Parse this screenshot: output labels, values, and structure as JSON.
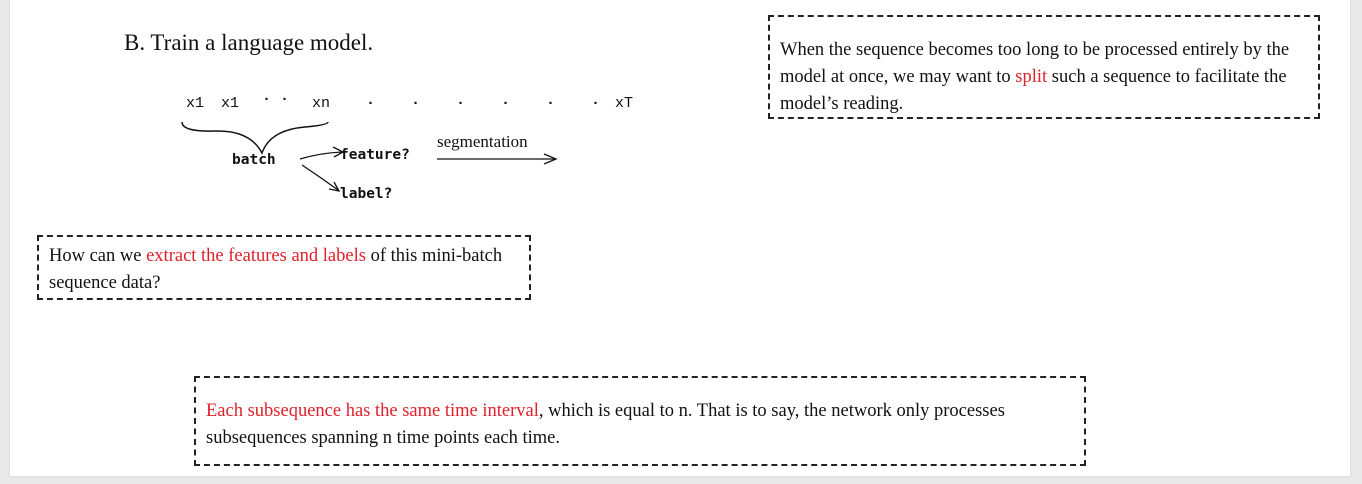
{
  "title": "B. Train a language model.",
  "sequence": {
    "x1a": "x1",
    "x1b": "x1",
    "dots1": "· ·",
    "xn": "xn",
    "dots2": "·    ·    ·    ·    ·    ·",
    "xT": "xT"
  },
  "diagram": {
    "batch": "batch",
    "feature": "feature?",
    "label": "label?",
    "segmentation": "segmentation"
  },
  "box_top_right": {
    "text_a": "When the sequence becomes too long to be processed entirely by the model at once, we may want to ",
    "highlight": "split",
    "text_b": " such a sequence to facilitate the model’s reading."
  },
  "box_left": {
    "text_a": "How can we ",
    "highlight": "extract the features and labels",
    "text_b": " of this mini-batch sequence data?"
  },
  "box_bottom": {
    "highlight": "Each subsequence has the same time interval",
    "text_b": ", which is equal to n. That is to say, the network only processes subsequences spanning n time points each time."
  },
  "colors": {
    "accent": "#e0202a",
    "text": "#111111"
  }
}
